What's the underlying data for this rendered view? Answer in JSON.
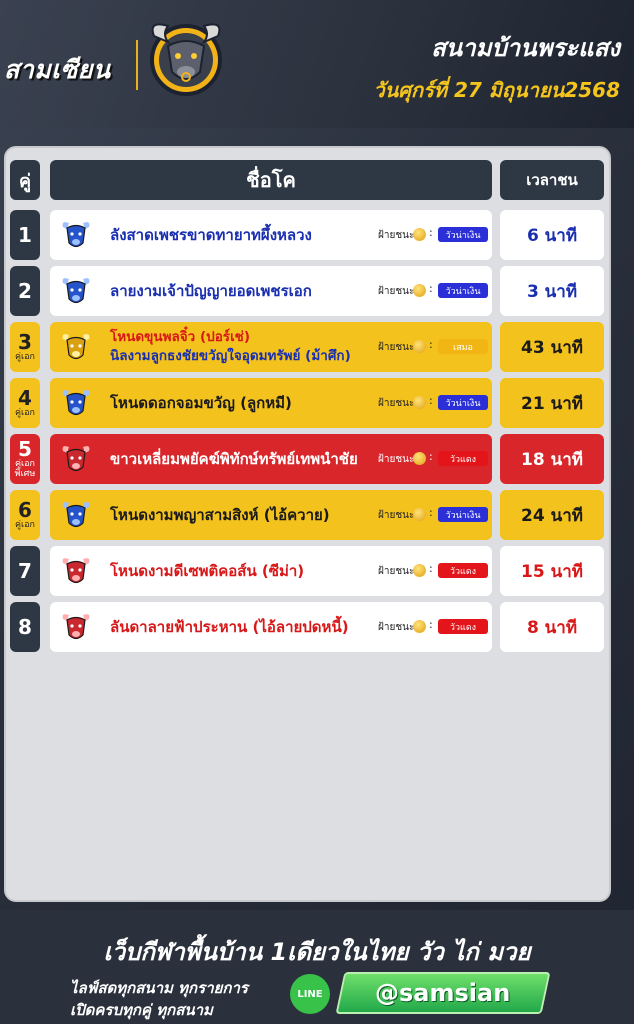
{
  "header": {
    "brand": "สามเซียน",
    "venue": "สนามบ้านพระแสง",
    "date": "วันศุกร์ที่ 27 มิถุนายน2568"
  },
  "table": {
    "col_pair": "คู่",
    "col_name": "ชื่อโค",
    "col_time": "เวลาชน",
    "rows": [
      {
        "no": "1",
        "tag": "",
        "names": [
          "ลังสาดเพชรขาดทายาทผึ้งหลวง"
        ],
        "win_label": "ฝ้ายชนะ",
        "badge": "วัวน่าเงิน",
        "time": "6 นาที",
        "style": "white",
        "bull": "blue"
      },
      {
        "no": "2",
        "tag": "",
        "names": [
          "ลายงามเจ้าปัญญายอดเพชรเอก"
        ],
        "win_label": "ฝ้ายชนะ",
        "badge": "วัวน่าเงิน",
        "time": "3 นาที",
        "style": "white",
        "bull": "blue"
      },
      {
        "no": "3",
        "tag": "คู่เอก",
        "names": [
          "โหนดขุนพลจิ๋ว (ปอร์เช่)",
          "นิลงามลูกธงชัยขวัญใจอุดมทรัพย์ (ม้าศึก)"
        ],
        "win_label": "ฝ้ายชนะ",
        "badge": "เสมอ",
        "time": "43 นาที",
        "style": "gold",
        "bull": "gold"
      },
      {
        "no": "4",
        "tag": "คู่เอก",
        "names": [
          "โหนดดอกจอมขวัญ (ลูกหมี)"
        ],
        "win_label": "ฝ้ายชนะ",
        "badge": "วัวน่าเงิน",
        "time": "21 นาที",
        "style": "gold",
        "bull": "blue"
      },
      {
        "no": "5",
        "tag": "คู่เอก พิเศษ",
        "names": [
          "ขาวเหลี่ยมพยัคฆ์พิทักษ์ทรัพย์เทพนำชัย"
        ],
        "win_label": "ฝ้ายชนะ",
        "badge": "วัวแดง",
        "time": "18 นาที",
        "style": "red",
        "bull": "red"
      },
      {
        "no": "6",
        "tag": "คู่เอก",
        "names": [
          "โหนดงามพญาสามสิงห์ (ไอ้ควาย)"
        ],
        "win_label": "ฝ้ายชนะ",
        "badge": "วัวน่าเงิน",
        "time": "24 นาที",
        "style": "gold",
        "bull": "blue"
      },
      {
        "no": "7",
        "tag": "",
        "names": [
          "โหนดงามดีเซพติคอส์น (ซีม่า)"
        ],
        "win_label": "ฝ้ายชนะ",
        "badge": "วัวแดง",
        "time": "15 นาที",
        "style": "white",
        "bull": "red"
      },
      {
        "no": "8",
        "tag": "",
        "names": [
          "ลันดาลายฟ้าประหาน (ไอ้ลายปดหนี้)"
        ],
        "win_label": "ฝ้ายชนะ",
        "badge": "วัวแดง",
        "time": "8 นาที",
        "style": "white",
        "bull": "red"
      }
    ]
  },
  "footer": {
    "slogan": "เว็บกีฬาพื้นบ้าน 1เดียวในไทย วัว ไก่ มวย",
    "line1": "ไลฟ์สดทุกสนาม ทุกรายการ",
    "line2": "เปิดครบทุกคู่ ทุกสนาม",
    "line_icon_text": "LINE",
    "handle": "@samsian"
  },
  "colors": {
    "navy": "#2e3744",
    "gold": "#f4c21d",
    "red": "#d8262b",
    "blue_text": "#1a2fb0",
    "red_text": "#d81818",
    "badge_blue": "#2a2fd8",
    "badge_red": "#e3141a",
    "badge_gold": "#f2b614"
  },
  "icons": {
    "brand_logo": "bull-head-logo",
    "row_icon": "bull-head-icon",
    "coin": "coin-icon",
    "line": "line-app-icon"
  }
}
